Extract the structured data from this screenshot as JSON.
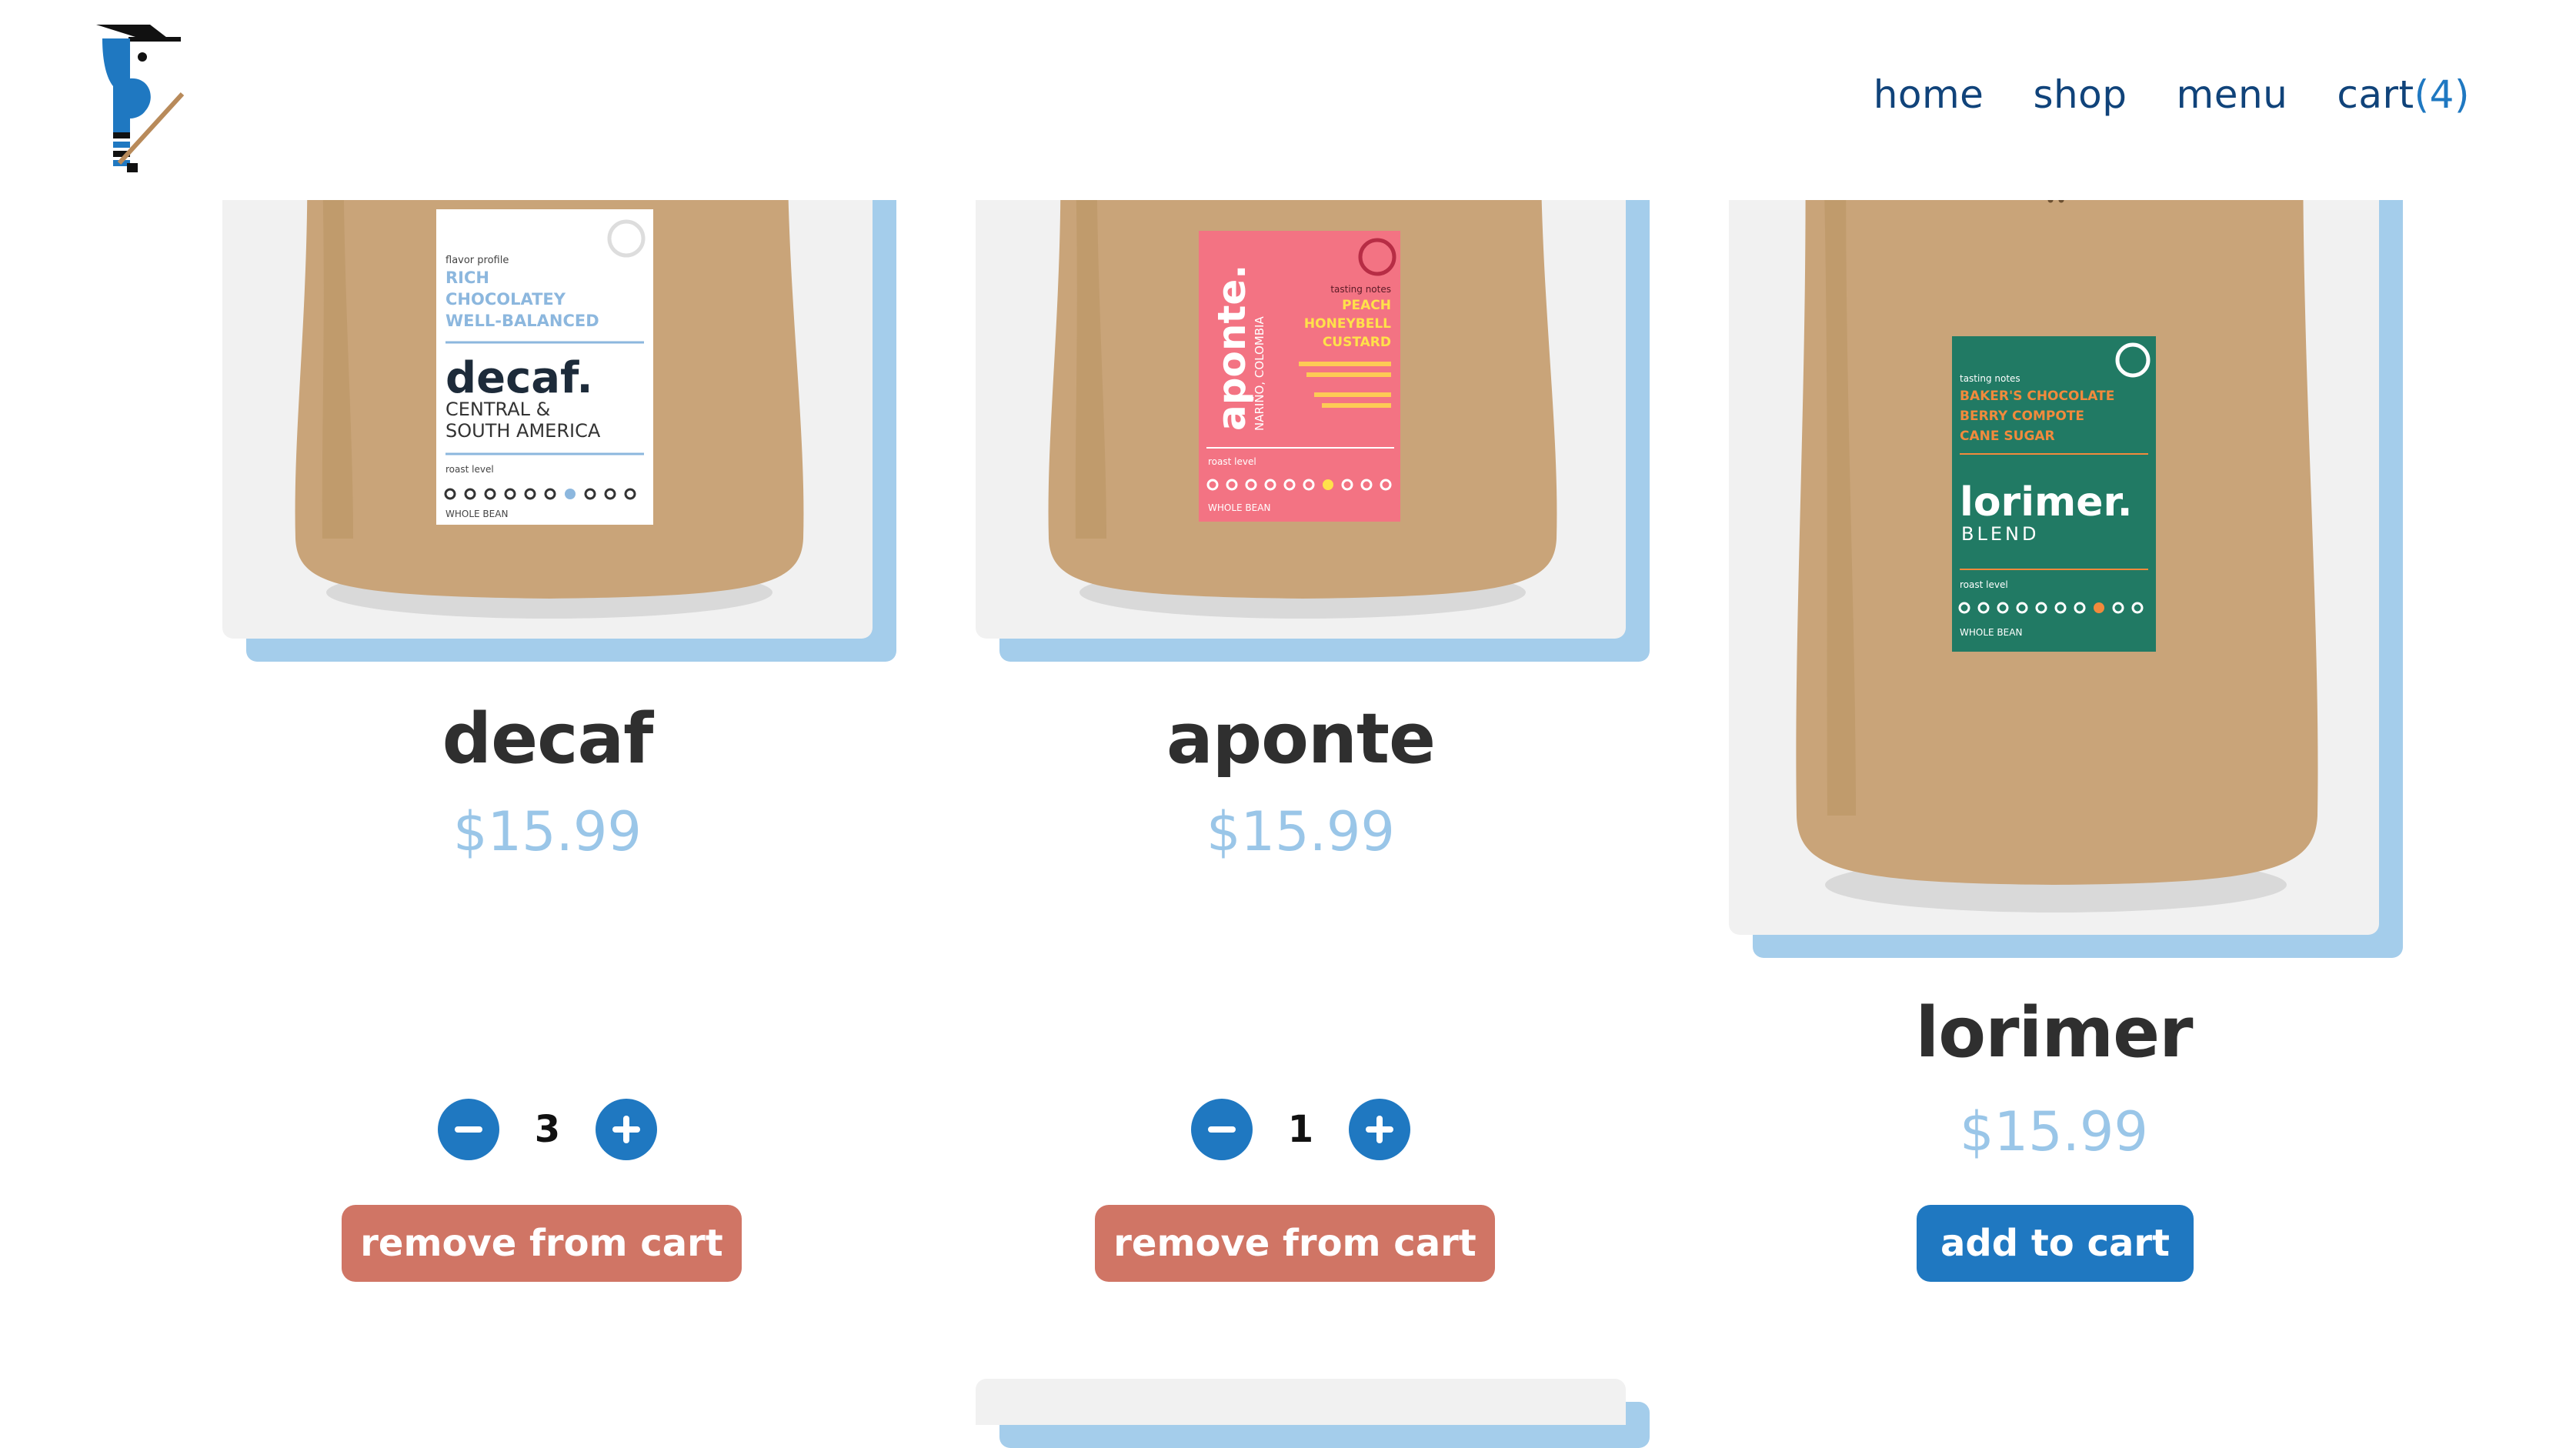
{
  "nav": {
    "links": [
      "home",
      "shop",
      "menu"
    ],
    "cart_label": "cart",
    "cart_count": "(4)"
  },
  "products": [
    {
      "name": "decaf",
      "price": "$15.99",
      "quantity": "3",
      "action_label": "remove from cart",
      "label_color": "#ffffff",
      "label": {
        "notes_heading": "flavor profile",
        "notes": [
          "RICH",
          "CHOCOLATEY",
          "WELL-BALANCED"
        ],
        "title": "decaf.",
        "subtitle_lines": [
          "CENTRAL &",
          "SOUTH AMERICA"
        ],
        "roast_label": "roast level",
        "footer": "WHOLE BEAN"
      }
    },
    {
      "name": "aponte",
      "price": "$15.99",
      "quantity": "1",
      "action_label": "remove from cart",
      "label_color": "#f37383",
      "label": {
        "notes_heading": "tasting notes",
        "notes": [
          "PEACH",
          "HONEYBELL",
          "CUSTARD"
        ],
        "title": "aponte.",
        "subtitle_lines": [
          "NARIÑO, COLOMBIA"
        ],
        "roast_label": "roast level",
        "footer": "WHOLE BEAN"
      }
    },
    {
      "name": "lorimer",
      "price": "$15.99",
      "action_label": "add to cart",
      "label_color": "#217a64",
      "label": {
        "notes_heading": "tasting notes",
        "notes": [
          "BAKER'S CHOCOLATE",
          "BERRY COMPOTE",
          "CANE SUGAR"
        ],
        "title": "lorimer.",
        "subtitle_lines": [
          "BLEND"
        ],
        "roast_label": "roast level",
        "footer": "WHOLE BEAN"
      }
    }
  ],
  "colors": {
    "nav_text": "#10437a",
    "accent_blue": "#1f78c1",
    "price": "#9ac6e8",
    "card_shadow": "#a4cdeb",
    "remove_button": "#d07565",
    "kraft_bag": "#c9a479"
  }
}
